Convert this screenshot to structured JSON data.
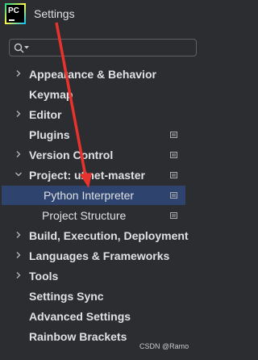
{
  "window": {
    "title": "Settings",
    "logo_text": "PC"
  },
  "search": {
    "placeholder": "",
    "value": ""
  },
  "tree": [
    {
      "label": "Appearance & Behavior",
      "chevron": "right",
      "project_icon": false
    },
    {
      "label": "Keymap",
      "chevron": "none",
      "project_icon": false
    },
    {
      "label": "Editor",
      "chevron": "right",
      "project_icon": false
    },
    {
      "label": "Plugins",
      "chevron": "none",
      "project_icon": true
    },
    {
      "label": "Version Control",
      "chevron": "right",
      "project_icon": true
    },
    {
      "label": "Project: u2net-master",
      "chevron": "down",
      "project_icon": true
    },
    {
      "label": "Python Interpreter",
      "chevron": "none",
      "project_icon": true,
      "child": true,
      "selected": true
    },
    {
      "label": "Project Structure",
      "chevron": "none",
      "project_icon": true,
      "child": true
    },
    {
      "label": "Build, Execution, Deployment",
      "chevron": "right",
      "project_icon": false
    },
    {
      "label": "Languages & Frameworks",
      "chevron": "right",
      "project_icon": false
    },
    {
      "label": "Tools",
      "chevron": "right",
      "project_icon": false
    },
    {
      "label": "Settings Sync",
      "chevron": "none",
      "project_icon": false
    },
    {
      "label": "Advanced Settings",
      "chevron": "none",
      "project_icon": false
    },
    {
      "label": "Rainbow Brackets",
      "chevron": "none",
      "project_icon": false
    }
  ],
  "watermark": "CSDN @Ramo",
  "colors": {
    "background": "#2b2d30",
    "selection": "#2e436e",
    "arrow": "#e8322d",
    "text": "#dfe1e5"
  }
}
